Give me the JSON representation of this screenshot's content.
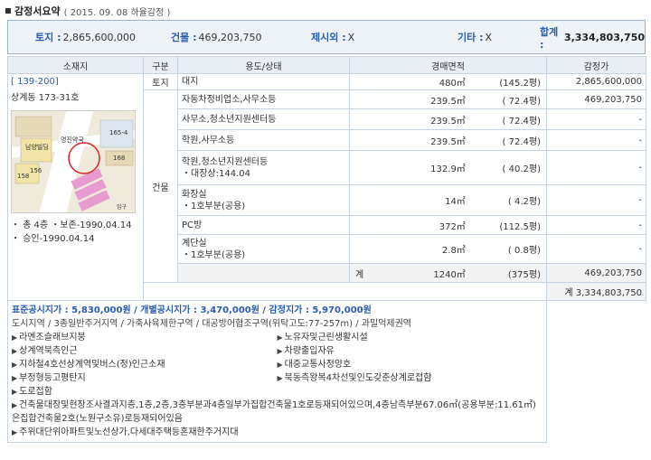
{
  "header": {
    "title": "감정서요약",
    "subtitle": "( 2015. 09. 08  하율감정 )"
  },
  "summary": {
    "land_label": "토지 :",
    "land_value": "2,865,600,000",
    "building_label": "건물 :",
    "building_value": "469,203,750",
    "exclusion_label": "제시외 :",
    "exclusion_value": "X",
    "other_label": "기타 :",
    "other_value": "X",
    "total_label": "합계 :",
    "total_value": "3,334,803,750"
  },
  "table": {
    "headers": [
      "소재지",
      "구분",
      "용도/상태",
      "경매면적",
      "감정가"
    ],
    "location": {
      "code": "[ 139-200]",
      "address": "상계동 173-31호",
      "notes": [
        "・ 총 4층  ・보존-1990.04.14",
        "・ 승인-1990.04.14"
      ]
    },
    "land_row": {
      "gubun": "토지",
      "use": "대지",
      "area": "480㎡",
      "pyeong": "(145.2평)",
      "price": "2,865,600,000"
    },
    "building_gubun": "건물",
    "building_rows": [
      {
        "use": "자동차정비업소,사무소등",
        "sub": "",
        "area": "239.5㎡",
        "pyeong": "( 72.4평)",
        "price": "469,203,750"
      },
      {
        "use": "사무소,청소년지원센터등",
        "sub": "",
        "area": "239.5㎡",
        "pyeong": "( 72.4평)",
        "price": "-"
      },
      {
        "use": "학원,사무소등",
        "sub": "",
        "area": "239.5㎡",
        "pyeong": "( 72.4평)",
        "price": "-"
      },
      {
        "use": "학원,청소년지원센터등",
        "sub": "・대장상:144.04",
        "area": "132.9㎡",
        "pyeong": "( 40.2평)",
        "price": "-"
      },
      {
        "use": "화장실",
        "sub": "・1호부분(공용)",
        "area": "14㎡",
        "pyeong": "( 4.2평)",
        "price": "-"
      },
      {
        "use": "PC방",
        "sub": "",
        "area": "372㎡",
        "pyeong": "(112.5평)",
        "price": "-"
      },
      {
        "use": "계단실",
        "sub": "・1호부분(공용)",
        "area": "2.8㎡",
        "pyeong": "( 0.8평)",
        "price": "-"
      }
    ],
    "subtotal": {
      "label": "계",
      "area": "1240㎡",
      "pyeong": "(375평)",
      "price": "469,203,750"
    },
    "grand_total": "계  3,334,803,750"
  },
  "notes": {
    "public_price": "표준공시지가 : 5,830,000원 / 개별공시지가 : 3,470,000원 / 감정지가 : 5,970,000원",
    "zoning": "도시지역 / 3종일반주거지역 / 가축사육제한구역 / 대공방어협조구역(위탁고도:77-257m) / 과밀억제권역",
    "items_two_col": [
      "라멘조슬래브지붕",
      "노유자및근린생활시설",
      "상계역북측인근",
      "차량출입자유",
      "지하철4호선상계역및버스(정)인근소재",
      "대중교통사정양호",
      "부정형등고평탄지",
      "북동측왕복4차선및인도갖춘상계로접함"
    ],
    "items_full": [
      "도로접함",
      "건축물대장및현장조사결과지층,1층,2층,3층부분과4층일부가집합건축물1호로등재되어있으며,4층남측부분67.06㎡(공용부분:11.61㎡)은집합건축물2호(노원구소유)로등재되어있음",
      "주위대단위아파트및노선상가,다세대주택등혼재한주거지대"
    ]
  },
  "map": {
    "labels": [
      "남양빌딩",
      "명진약국",
      "156",
      "165-4",
      "168",
      "158",
      "입구"
    ]
  }
}
